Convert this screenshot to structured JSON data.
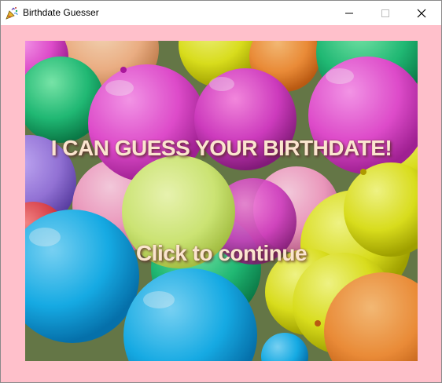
{
  "window": {
    "title": "Birthdate Guesser",
    "icon": "party-popper-icon",
    "controls": [
      "minimize-icon",
      "maximize-icon",
      "close-icon"
    ]
  },
  "splash": {
    "headline": "I CAN GUESS YOUR BIRTHDATE!",
    "cta": "Click to continue"
  },
  "colors": {
    "frame": "#ffc0cb",
    "text": "#fbe5cf",
    "titlebar": "#ffffff"
  }
}
